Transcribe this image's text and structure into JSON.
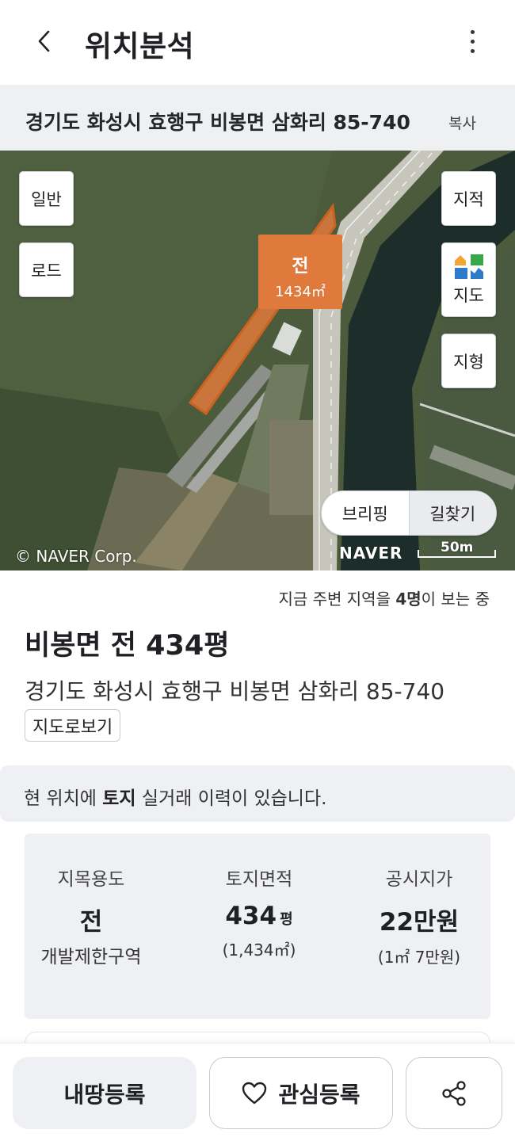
{
  "header": {
    "title": "위치분석",
    "back_icon": "chevron-left-icon",
    "more_icon": "more-vertical-icon"
  },
  "address_bar": {
    "address": "경기도 화성시 효행구 비봉면 삼화리 85-740",
    "copy_label": "복사"
  },
  "map": {
    "left_buttons": [
      "일반",
      "로드"
    ],
    "right_buttons": {
      "cadastral": "지적",
      "map": "지도",
      "terrain": "지형"
    },
    "parcel": {
      "type": "전",
      "area": "1434㎡",
      "highlight_color": "#e07a3c"
    },
    "briefing_label": "브리핑",
    "route_label": "길찾기",
    "copyright": "© NAVER Corp.",
    "logo": "NAVER",
    "scale": "50m"
  },
  "info": {
    "viewers_prefix": "지금 주변 지역을 ",
    "viewers_count": "4명",
    "viewers_suffix": "이 보는 중",
    "title": "비봉면 전 434평",
    "address": "경기도 화성시 효행구 비봉면 삼화리 85-740",
    "view_road_label": "지도로보기"
  },
  "trade_notice": {
    "prefix": "현 위치에 ",
    "highlight": "토지",
    "suffix": " 실거래 이력이 있습니다."
  },
  "stats": [
    {
      "label": "지목용도",
      "value": "전",
      "unit": "",
      "sub": "개발제한구역"
    },
    {
      "label": "토지면적",
      "value": "434",
      "unit": "평",
      "sub": "(1,434㎡)"
    },
    {
      "label": "공시지가",
      "value": "22만원",
      "unit": "",
      "sub": "(1㎡ 7만원)"
    }
  ],
  "bottom_bar": {
    "register_label": "내땅등록",
    "interest_label": "관심등록",
    "interest_icon": "heart-icon",
    "share_icon": "share-icon"
  }
}
